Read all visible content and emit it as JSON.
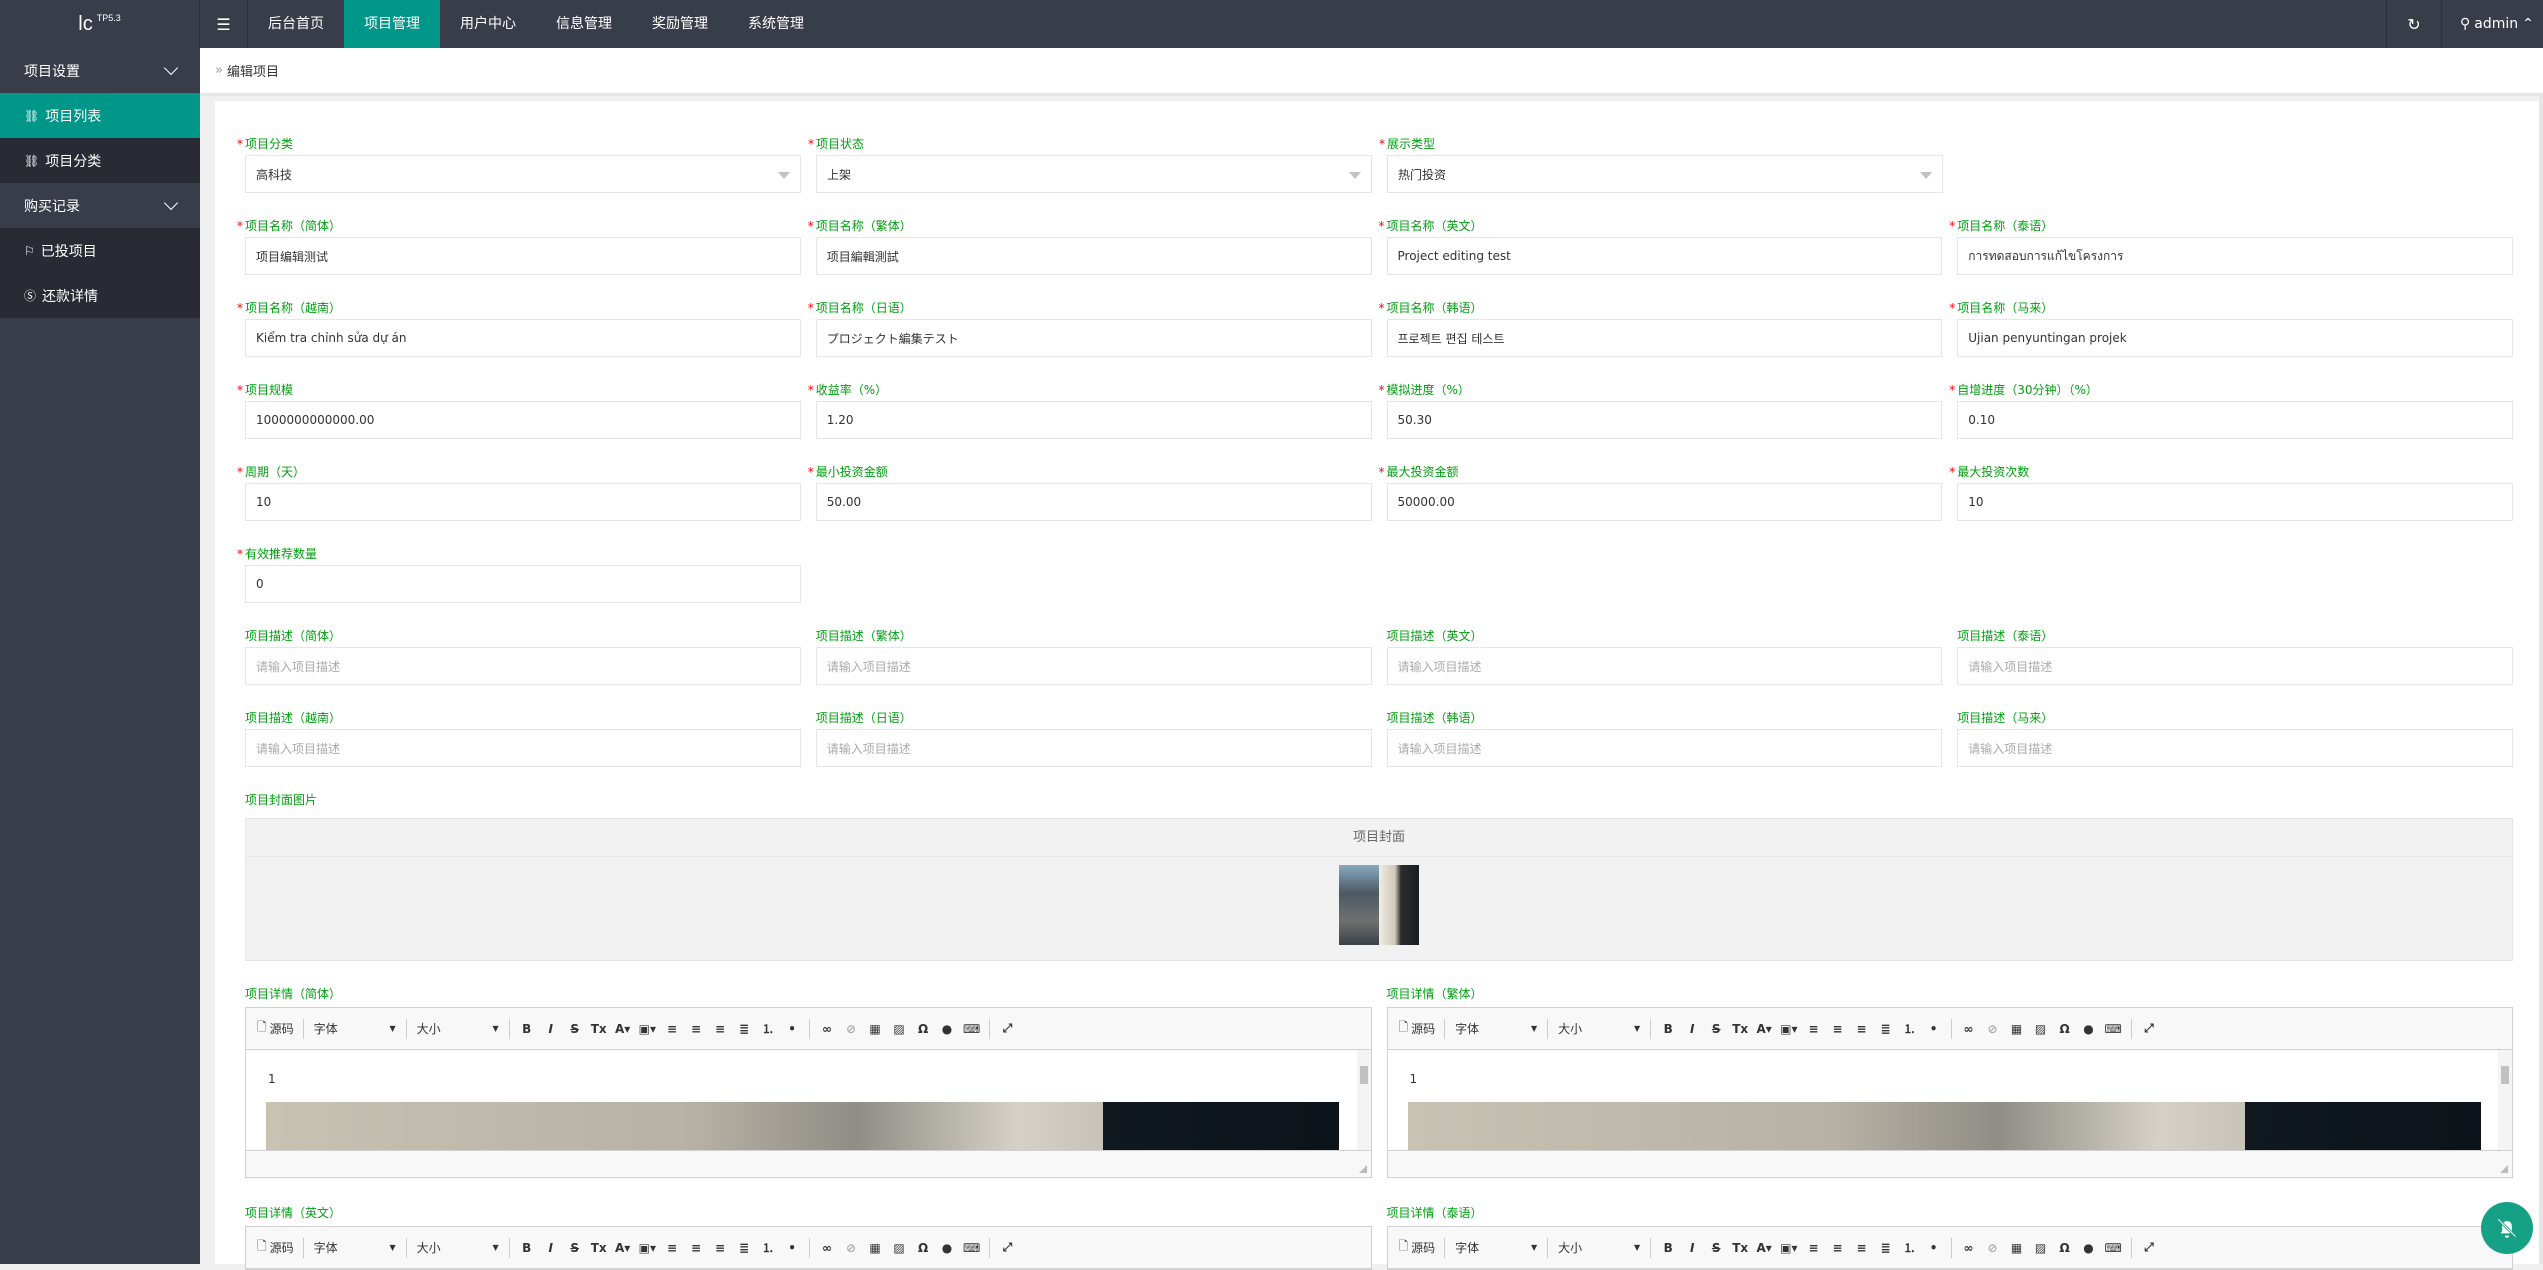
{
  "header": {
    "logo": "lc",
    "logo_sup": "TP5.3",
    "menu_icon": "hamburger-icon",
    "nav": [
      {
        "label": "后台首页",
        "active": false
      },
      {
        "label": "项目管理",
        "active": true
      },
      {
        "label": "用户中心",
        "active": false
      },
      {
        "label": "信息管理",
        "active": false
      },
      {
        "label": "奖励管理",
        "active": false
      },
      {
        "label": "系统管理",
        "active": false
      }
    ],
    "refresh_icon": "refresh-icon",
    "user": "admin",
    "accent": "#009688"
  },
  "sidebar": {
    "groups": [
      {
        "label": "项目设置",
        "items": [
          {
            "label": "项目列表",
            "icon": "link-icon",
            "active": true
          },
          {
            "label": "项目分类",
            "icon": "link-icon",
            "active": false
          }
        ]
      },
      {
        "label": "购买记录",
        "items": [
          {
            "label": "已投项目",
            "icon": "flag-icon",
            "active": false
          },
          {
            "label": "还款详情",
            "icon": "dollar-icon",
            "active": false
          }
        ]
      }
    ]
  },
  "breadcrumb": {
    "sep": "»",
    "current": "编辑项目"
  },
  "form": {
    "row1": [
      {
        "label": "项目分类",
        "value": "高科技",
        "type": "select"
      },
      {
        "label": "项目状态",
        "value": "上架",
        "type": "select"
      },
      {
        "label": "展示类型",
        "value": "热门投资",
        "type": "select"
      }
    ],
    "row2": [
      {
        "label": "项目名称（简体）",
        "value": "项目编辑测试"
      },
      {
        "label": "项目名称（繁体）",
        "value": "项目編輯測試"
      },
      {
        "label": "项目名称（英文）",
        "value": "Project editing test"
      },
      {
        "label": "项目名称（泰语）",
        "value": "การทดสอบการแก้ไขโครงการ"
      }
    ],
    "row3": [
      {
        "label": "项目名称（越南）",
        "value": "Kiểm tra chỉnh sửa dự án"
      },
      {
        "label": "项目名称（日语）",
        "value": "プロジェクト編集テスト"
      },
      {
        "label": "项目名称（韩语）",
        "value": "프로젝트 편집 테스트"
      },
      {
        "label": "项目名称（马来）",
        "value": "Ujian penyuntingan projek"
      }
    ],
    "row4": [
      {
        "label": "项目规模",
        "value": "1000000000000.00"
      },
      {
        "label": "收益率（%）",
        "value": "1.20"
      },
      {
        "label": "模拟进度（%）",
        "value": "50.30"
      },
      {
        "label": "自增进度（30分钟）（%）",
        "value": "0.10"
      }
    ],
    "row5": [
      {
        "label": "周期（天）",
        "value": "10"
      },
      {
        "label": "最小投资金额",
        "value": "50.00"
      },
      {
        "label": "最大投资金额",
        "value": "50000.00"
      },
      {
        "label": "最大投资次数",
        "value": "10"
      }
    ],
    "row6": [
      {
        "label": "有效推荐数量",
        "value": "0"
      }
    ],
    "desc_row1": [
      {
        "label": "项目描述（简体）",
        "placeholder": "请输入项目描述"
      },
      {
        "label": "项目描述（繁体）",
        "placeholder": "请输入项目描述"
      },
      {
        "label": "项目描述（英文）",
        "placeholder": "请输入项目描述"
      },
      {
        "label": "项目描述（泰语）",
        "placeholder": "请输入项目描述"
      }
    ],
    "desc_row2": [
      {
        "label": "项目描述（越南）",
        "placeholder": "请输入项目描述"
      },
      {
        "label": "项目描述（日语）",
        "placeholder": "请输入项目描述"
      },
      {
        "label": "项目描述（韩语）",
        "placeholder": "请输入项目描述"
      },
      {
        "label": "项目描述（马来）",
        "placeholder": "请输入项目描述"
      }
    ],
    "cover": {
      "label": "项目封面图片",
      "header": "项目封面"
    },
    "editors": [
      {
        "label": "项目详情（简体）",
        "content": "1"
      },
      {
        "label": "项目详情（繁体）",
        "content": "1"
      }
    ],
    "editors_next": [
      {
        "label": "项目详情（英文）"
      },
      {
        "label": "项目详情（泰语）"
      }
    ],
    "toolbar": {
      "source": "源码",
      "font": "字体",
      "size": "大小",
      "buttons": [
        {
          "glyph": "B",
          "name": "bold-icon"
        },
        {
          "glyph": "I",
          "name": "italic-icon"
        },
        {
          "glyph": "S",
          "name": "strikethrough-icon"
        },
        {
          "glyph": "Tx",
          "name": "remove-format-icon"
        },
        {
          "glyph": "A▾",
          "name": "text-color-icon"
        },
        {
          "glyph": "▣▾",
          "name": "bg-color-icon"
        },
        {
          "glyph": "≡",
          "name": "align-left-icon"
        },
        {
          "glyph": "≡",
          "name": "align-center-icon"
        },
        {
          "glyph": "≡",
          "name": "align-right-icon"
        },
        {
          "glyph": "≣",
          "name": "justify-icon"
        },
        {
          "glyph": "⒈",
          "name": "numbered-list-icon"
        },
        {
          "glyph": "•",
          "name": "bullet-list-icon"
        },
        {
          "glyph": "∞",
          "name": "link-icon"
        },
        {
          "glyph": "⊘",
          "name": "unlink-icon"
        },
        {
          "glyph": "▦",
          "name": "table-icon"
        },
        {
          "glyph": "▨",
          "name": "image-icon"
        },
        {
          "glyph": "Ω",
          "name": "special-char-icon"
        },
        {
          "glyph": "●",
          "name": "flash-icon"
        },
        {
          "glyph": "⌨",
          "name": "div-icon"
        },
        {
          "glyph": "⤢",
          "name": "maximize-icon"
        }
      ]
    }
  },
  "fab": {
    "icon": "bell-off-icon",
    "color": "#16a085"
  }
}
